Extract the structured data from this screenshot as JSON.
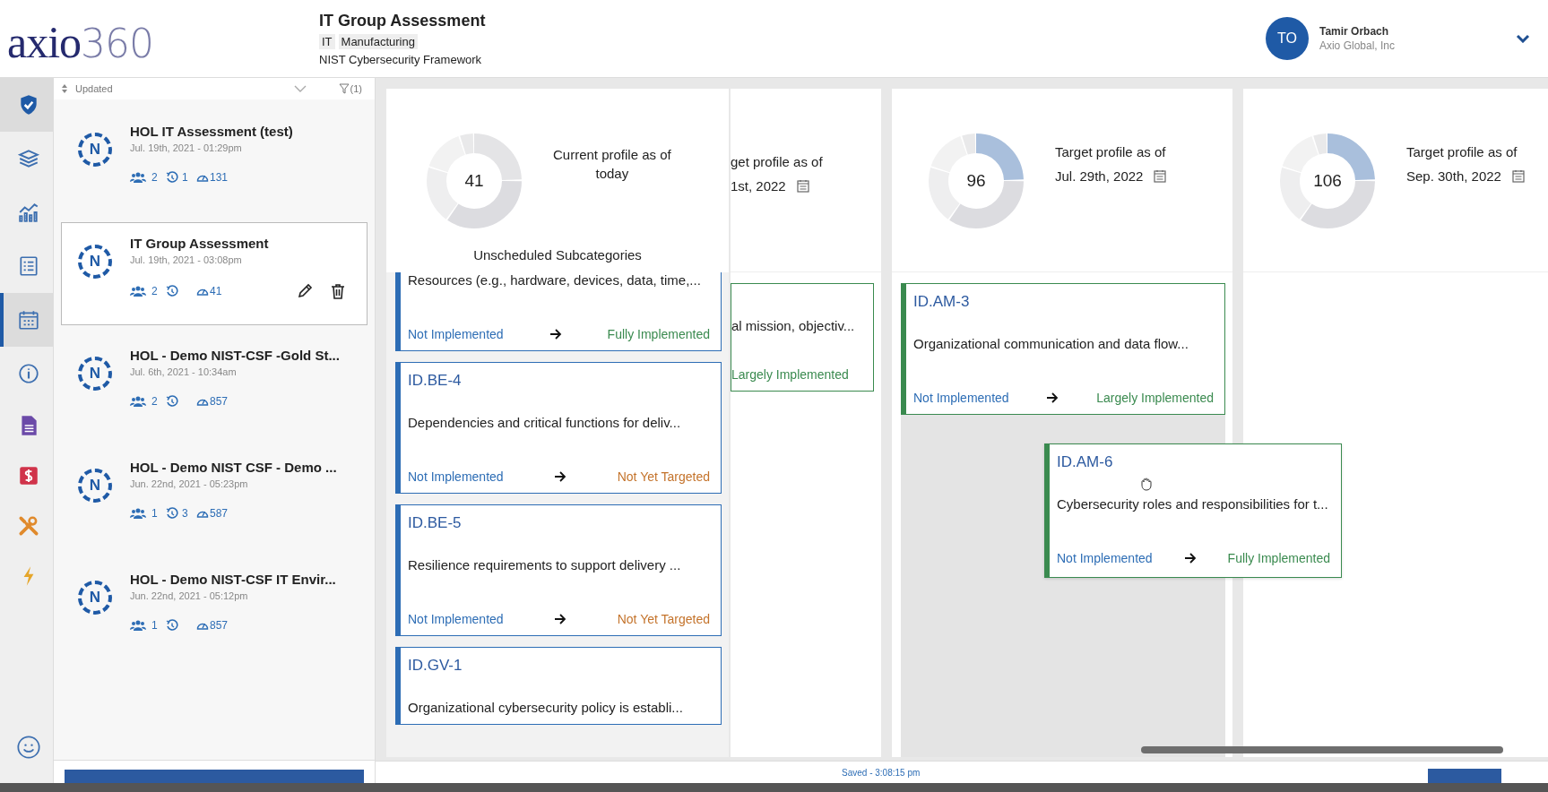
{
  "header": {
    "logo": {
      "brand": "axio",
      "suffix": "360"
    },
    "title": "IT Group Assessment",
    "tags": [
      "IT",
      "Manufacturing"
    ],
    "framework": "NIST Cybersecurity Framework",
    "user": {
      "initials": "TO",
      "name": "Tamir Orbach",
      "org": "Axio Global, Inc"
    }
  },
  "rail": [
    {
      "selected": false,
      "hovered": true
    },
    {
      "selected": false,
      "hovered": false
    },
    {
      "selected": false,
      "hovered": false
    },
    {
      "selected": false,
      "hovered": false
    },
    {
      "selected": true,
      "hovered": false
    },
    {
      "selected": false,
      "hovered": false
    },
    {
      "selected": false,
      "hovered": false
    },
    {
      "selected": false,
      "hovered": false
    },
    {
      "selected": false,
      "hovered": false
    },
    {
      "selected": false,
      "hovered": false
    },
    {
      "selected": false,
      "hovered": false
    }
  ],
  "list": {
    "sort": "Updated",
    "filter": "(1)",
    "items": [
      {
        "letter": "N",
        "title": "HOL IT Assessment (test)",
        "date": "Jul. 19th, 2021 - 01:29pm",
        "members": "2",
        "history": "1",
        "score": "131",
        "selected": false
      },
      {
        "letter": "N",
        "title": "IT Group Assessment",
        "date": "Jul. 19th, 2021 - 03:08pm",
        "members": "2",
        "score": "41",
        "selected": true
      },
      {
        "letter": "N",
        "title": "HOL - Demo NIST-CSF -Gold St...",
        "date": "Jul. 6th, 2021 - 10:34am",
        "members": "2",
        "score": "857",
        "selected": false
      },
      {
        "letter": "N",
        "title": "HOL - Demo NIST CSF - Demo ...",
        "date": "Jun. 22nd, 2021 - 05:23pm",
        "members": "1",
        "history": "3",
        "score": "587",
        "selected": false
      },
      {
        "letter": "N",
        "title": "HOL - Demo NIST-CSF IT Envir...",
        "date": "Jun. 22nd, 2021 - 05:12pm",
        "members": "1",
        "score": "857",
        "selected": false
      }
    ]
  },
  "board": {
    "columns": [
      {
        "kind": "current",
        "count": "41",
        "label": "Current profile as of",
        "date": "today",
        "subtitle": "Unscheduled Subcategories",
        "cards": [
          {
            "description": "Resources (e.g., hardware, devices, data, time,...",
            "color": "#2d6db5",
            "from": {
              "text": "Not Implemented",
              "color": "#2d6db5"
            },
            "to": {
              "text": "Fully Implemented",
              "color": "#3a8a4f"
            }
          },
          {
            "code": "ID.BE-4",
            "description": "Dependencies and critical functions for deliv...",
            "color": "#2d6db5",
            "from": {
              "text": "Not Implemented",
              "color": "#2d6db5"
            },
            "to": {
              "text": "Not Yet Targeted",
              "color": "#c4732b"
            }
          },
          {
            "code": "ID.BE-5",
            "description": "Resilience requirements to support delivery ...",
            "color": "#2d6db5",
            "from": {
              "text": "Not Implemented",
              "color": "#2d6db5"
            },
            "to": {
              "text": "Not Yet Targeted",
              "color": "#c4732b"
            }
          },
          {
            "code": "ID.GV-1",
            "description": "Organizational cybersecurity policy is establi...",
            "color": "#2d6db5"
          }
        ]
      },
      {
        "kind": "partial",
        "label": "get profile as of",
        "date": "1st, 2022",
        "cards": [
          {
            "description": "al mission, objectiv...",
            "color": "#3a8a4f",
            "to": {
              "text": "Largely Implemented",
              "color": "#3a8a4f"
            }
          }
        ]
      },
      {
        "kind": "target",
        "count": "96",
        "label": "Target profile as of",
        "date": "Jul. 29th, 2022",
        "cards": [
          {
            "code": "ID.AM-3",
            "description": "Organizational communication and data flow...",
            "color": "#3a8a4f",
            "from": {
              "text": "Not Implemented",
              "color": "#2d6db5"
            },
            "to": {
              "text": "Largely Implemented",
              "color": "#3a8a4f"
            }
          }
        ],
        "dragged_card": {
          "code": "ID.AM-6",
          "description": "Cybersecurity roles and responsibilities for t...",
          "color": "#3a8a4f",
          "from": {
            "text": "Not Implemented",
            "color": "#2d6db5"
          },
          "to": {
            "text": "Fully Implemented",
            "color": "#3a8a4f"
          }
        }
      },
      {
        "kind": "target",
        "count": "106",
        "label": "Target profile as of",
        "date": "Sep. 30th, 2022"
      }
    ]
  },
  "status": "Saved - 3:08:15 pm"
}
